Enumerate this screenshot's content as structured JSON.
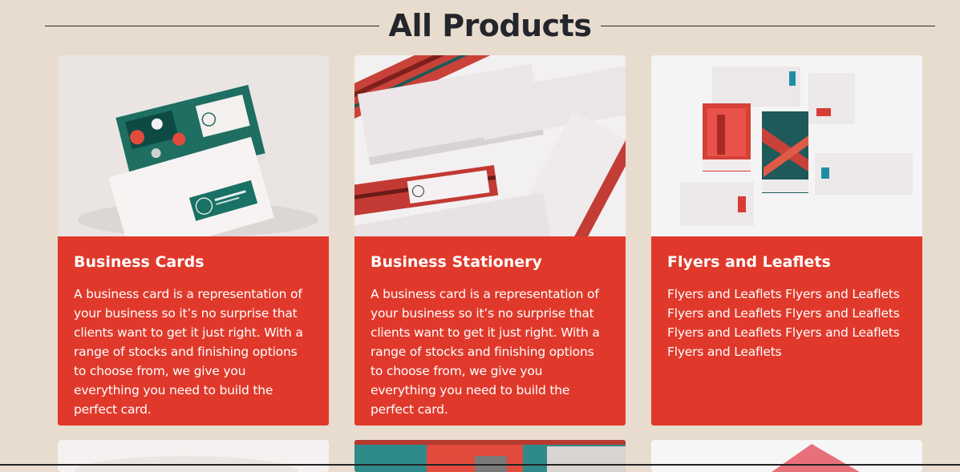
{
  "page": {
    "title": "All Products"
  },
  "colors": {
    "background": "#e8dccf",
    "card_accent": "#e0392b",
    "card_text": "#ffffff",
    "heading_text": "#23262b"
  },
  "products": [
    {
      "title": "Business Cards",
      "description": "A business card is a representation of your business so it’s no surprise that clients want to get it just right. With a range of stocks and finishing options to choose from, we give you everything you need to build the perfect card.",
      "image": "business-cards-photo"
    },
    {
      "title": "Business Stationery",
      "description": "A business card is a representation of your business so it’s no surprise that clients want to get it just right. With a range of stocks and finishing options to choose from, we give you everything you need to build the perfect card.",
      "image": "business-stationery-photo"
    },
    {
      "title": "Flyers and Leaflets",
      "description": "Flyers and Leaflets Flyers and Leaflets Flyers and Leaflets Flyers and Leaflets Flyers and Leaflets Flyers and Leaflets Flyers and Leaflets",
      "image": "flyers-leaflets-photo"
    }
  ]
}
